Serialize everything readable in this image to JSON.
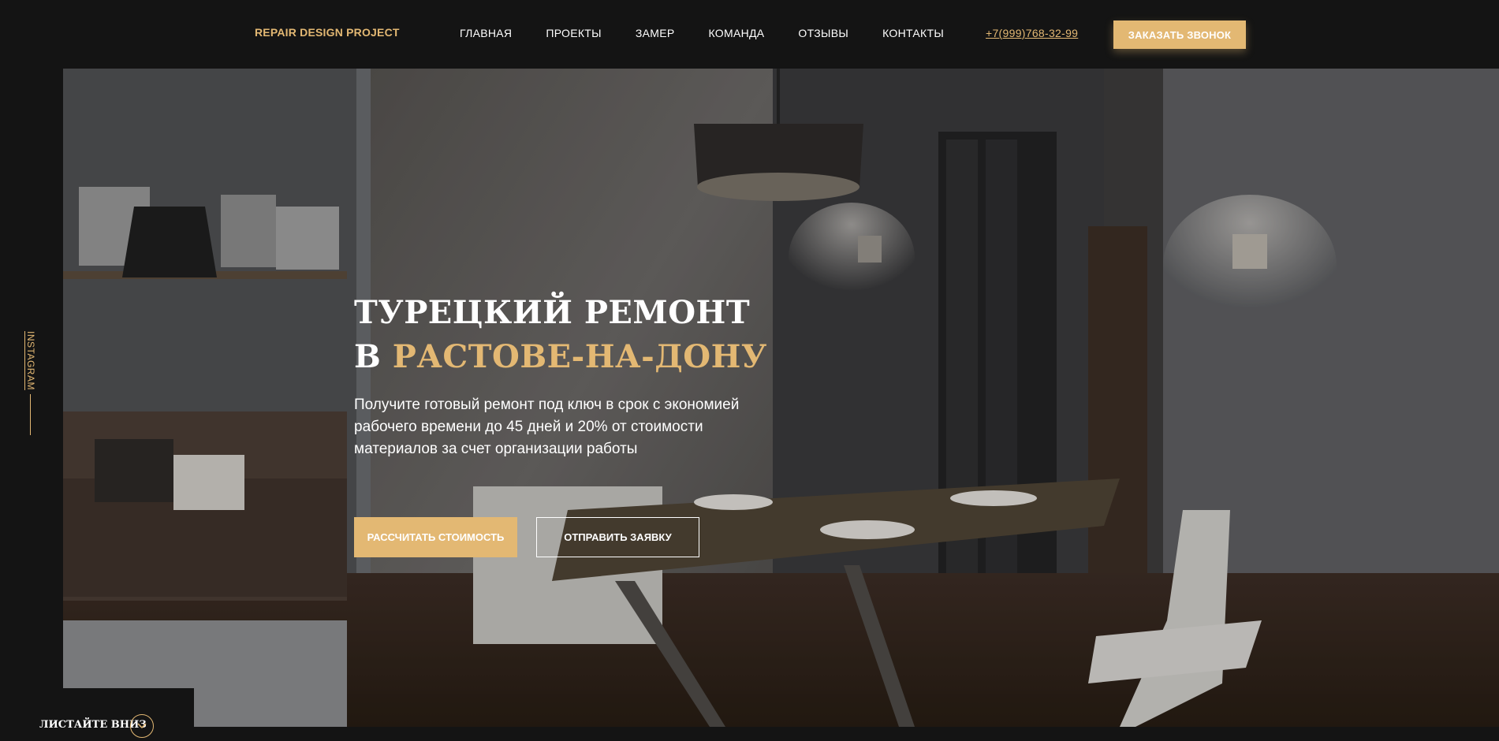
{
  "header": {
    "logo": "REPAIR DESIGN PROJECT",
    "nav": [
      "ГЛАВНАЯ",
      "ПРОЕКТЫ",
      "ЗАМЕР",
      "КОМАНДА",
      "ОТЗЫВЫ",
      "КОНТАКТЫ"
    ],
    "phone": "+7(999)768-32-99",
    "call_button": "ЗАКАЗАТЬ ЗВОНОК"
  },
  "hero": {
    "title_line1": "ТУРЕЦКИЙ РЕМОНТ",
    "title_prefix": "В",
    "title_accent": "РАСТОВЕ-НА-ДОНУ",
    "description": "Получите готовый ремонт под ключ в срок с экономией рабочего времени до 45 дней и 20% от стоимости материалов за счет организации работы",
    "calc_button": "РАССЧИТАТЬ СТОИМОСТЬ",
    "send_button": "ОТПРАВИТЬ ЗАЯВКУ"
  },
  "side": {
    "instagram": "INSTAGRAM",
    "scroll_label": "ЛИСТАЙТЕ ВНИЗ"
  },
  "colors": {
    "accent": "#e3b873",
    "background": "#141414"
  },
  "icons": {
    "scroll": "chevron-down-icon"
  }
}
